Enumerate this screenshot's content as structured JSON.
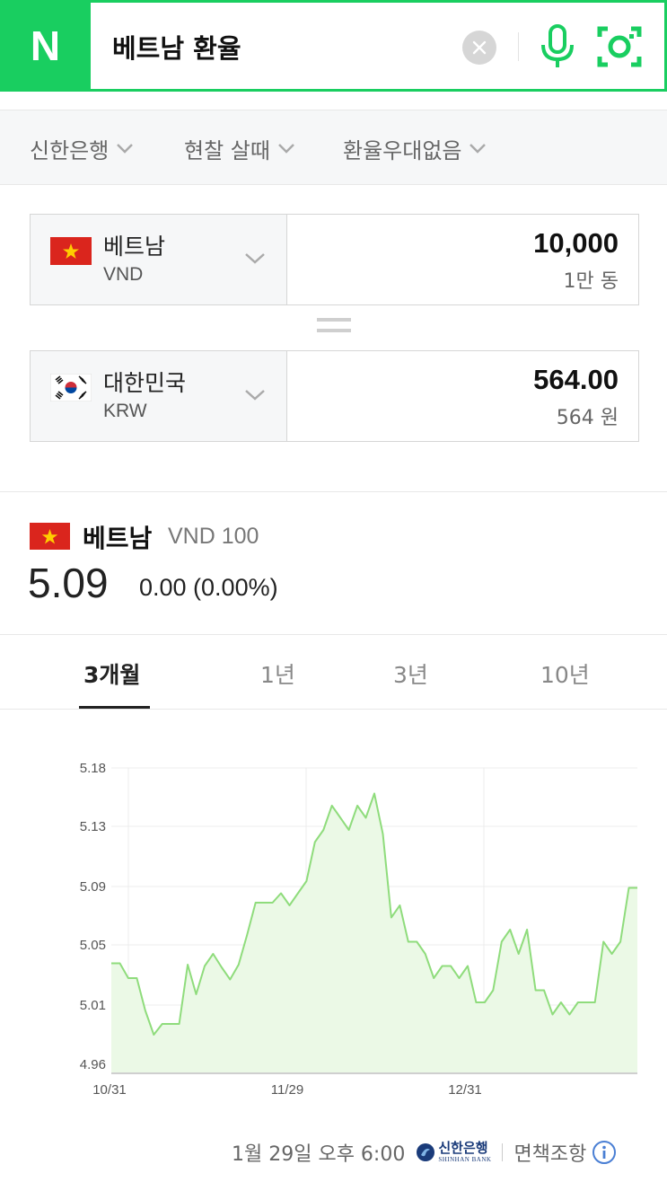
{
  "search": {
    "logo": "N",
    "query": "베트남 환율",
    "colors": {
      "brand": "#19ce60"
    }
  },
  "filters": [
    {
      "label": "신한은행"
    },
    {
      "label": "현찰 살때"
    },
    {
      "label": "환율우대없음"
    }
  ],
  "converter": {
    "from": {
      "name": "베트남",
      "code": "VND",
      "flag": "vietnam-flag",
      "amount": "10,000",
      "amount_text": "1만 동"
    },
    "to": {
      "name": "대한민국",
      "code": "KRW",
      "flag": "korea-flag",
      "amount": "564.00",
      "amount_text": "564 원"
    }
  },
  "rate": {
    "name": "베트남",
    "unit": "VND 100",
    "value": "5.09",
    "change": "0.00 (0.00%)"
  },
  "tabs": [
    {
      "label": "3개월",
      "active": true
    },
    {
      "label": "1년",
      "active": false
    },
    {
      "label": "3년",
      "active": false
    },
    {
      "label": "10년",
      "active": false
    }
  ],
  "chart_data": {
    "type": "area",
    "title": "",
    "xlabel": "",
    "ylabel": "",
    "y_ticks": [
      "5.18",
      "5.13",
      "5.09",
      "5.05",
      "5.01",
      "4.96"
    ],
    "x_ticks": [
      "10/31",
      "11/29",
      "12/31"
    ],
    "ylim": [
      4.96,
      5.18
    ],
    "grid": true,
    "colors": {
      "line": "#8fdc7c",
      "fill": "#ebf9e6"
    },
    "series": [
      {
        "values": [
          5.035,
          5.035,
          5.024,
          5.024,
          5.0,
          4.982,
          4.99,
          4.99,
          4.99,
          5.034,
          5.012,
          5.033,
          5.042,
          5.032,
          5.023,
          5.034,
          5.056,
          5.08,
          5.08,
          5.08,
          5.087,
          5.078,
          5.087,
          5.096,
          5.125,
          5.134,
          5.152,
          5.143,
          5.134,
          5.152,
          5.143,
          5.161,
          5.131,
          5.069,
          5.078,
          5.051,
          5.051,
          5.042,
          5.024,
          5.033,
          5.033,
          5.024,
          5.033,
          5.006,
          5.006,
          5.015,
          5.051,
          5.06,
          5.042,
          5.06,
          5.015,
          5.015,
          4.997,
          5.006,
          4.997,
          5.006,
          5.006,
          5.006,
          5.051,
          5.042,
          5.051,
          5.091,
          5.091
        ]
      }
    ]
  },
  "footer": {
    "timestamp": "1월 29일 오후 6:00",
    "bank_name": "신한은행",
    "bank_name_en": "SHINHAN BANK",
    "disclaimer": "면책조항"
  }
}
